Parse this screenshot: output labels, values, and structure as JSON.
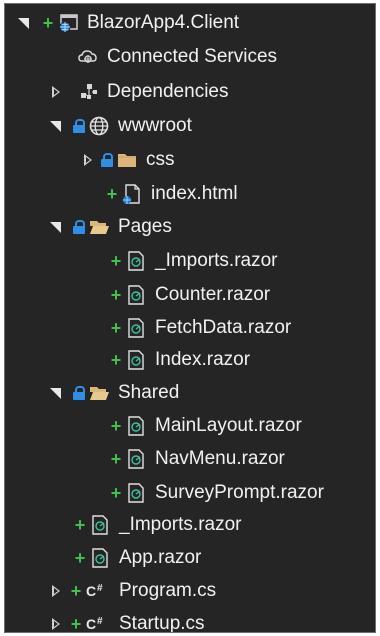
{
  "tree": {
    "project": "BlazorApp4.Client",
    "connected_services": "Connected Services",
    "dependencies": "Dependencies",
    "wwwroot": "wwwroot",
    "css": "css",
    "index_html": "index.html",
    "pages": "Pages",
    "pages_items": [
      "_Imports.razor",
      "Counter.razor",
      "FetchData.razor",
      "Index.razor"
    ],
    "shared": "Shared",
    "shared_items": [
      "MainLayout.razor",
      "NavMenu.razor",
      "SurveyPrompt.razor"
    ],
    "root_imports": "_Imports.razor",
    "app_razor": "App.razor",
    "program_cs": "Program.cs",
    "startup_cs": "Startup.cs"
  },
  "colors": {
    "background": "#252526",
    "text": "#f1f1f1",
    "add_glyph": "#3fc14a",
    "lock": "#2f8fe6",
    "folder": "#dcb67a"
  },
  "icons": {
    "project": "web-project-icon",
    "connected_services": "connected-services-icon",
    "dependencies": "dependencies-icon",
    "wwwroot": "globe-icon",
    "folder": "folder-icon",
    "html_file": "html-file-icon",
    "razor_file": "razor-file-icon",
    "csharp_file": "csharp-file-icon"
  }
}
